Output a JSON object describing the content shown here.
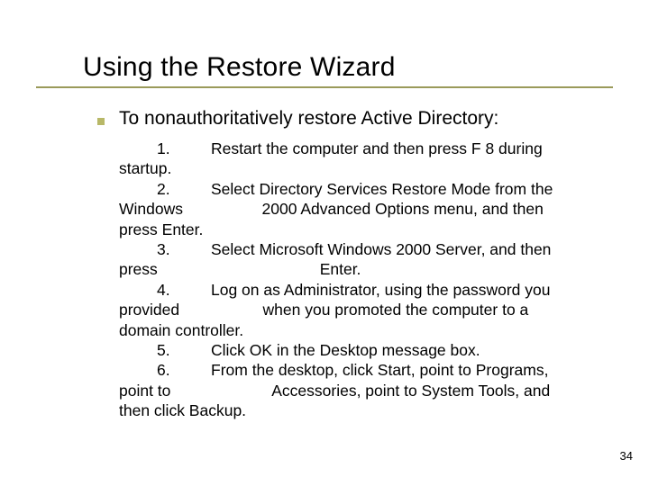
{
  "title": "Using the Restore Wizard",
  "lead": "To nonauthoritatively restore Active Directory:",
  "steps_html_lines": [
    "<span class='num'>1.</span><span class='gap'></span>Restart the computer and then press F 8 during",
    "startup.",
    "<span class='num'>2.</span><span class='gap'></span>Select Directory Services Restore Mode from the",
    "Windows&nbsp;&nbsp;&nbsp;&nbsp;&nbsp;&nbsp;&nbsp;&nbsp;&nbsp;&nbsp;&nbsp;&nbsp;&nbsp;&nbsp;&nbsp;&nbsp;&nbsp;&nbsp;2000 Advanced Options menu, and then",
    "press Enter.",
    "<span class='num'>3.</span><span class='gap'></span>Select Microsoft Windows 2000 Server, and then",
    "press&nbsp;&nbsp;&nbsp;&nbsp;&nbsp;&nbsp;&nbsp;&nbsp;&nbsp;&nbsp;&nbsp;&nbsp;&nbsp;&nbsp;&nbsp;&nbsp;&nbsp;&nbsp;&nbsp;&nbsp;&nbsp;&nbsp;&nbsp;&nbsp;&nbsp;&nbsp;&nbsp;&nbsp;&nbsp;&nbsp;&nbsp;&nbsp;&nbsp;&nbsp;&nbsp;&nbsp;&nbsp;Enter.",
    "<span class='num'>4.</span><span class='gap'></span>Log on as Administrator, using the password you",
    "provided&nbsp;&nbsp;&nbsp;&nbsp;&nbsp;&nbsp;&nbsp;&nbsp;&nbsp;&nbsp;&nbsp;&nbsp;&nbsp;&nbsp;&nbsp;&nbsp;&nbsp;&nbsp;&nbsp;when you promoted the computer to a",
    "domain controller.",
    "<span class='num'>5.</span><span class='gap'></span>Click OK in the Desktop message box.",
    "<span class='num'>6.</span><span class='gap'></span>From the desktop, click Start, point to Programs,",
    "point to&nbsp;&nbsp;&nbsp;&nbsp;&nbsp;&nbsp;&nbsp;&nbsp;&nbsp;&nbsp;&nbsp;&nbsp;&nbsp;&nbsp;&nbsp;&nbsp;&nbsp;&nbsp;&nbsp;&nbsp;&nbsp;&nbsp;&nbsp;Accessories, point to System Tools, and",
    "then click Backup."
  ],
  "page_number": "34"
}
